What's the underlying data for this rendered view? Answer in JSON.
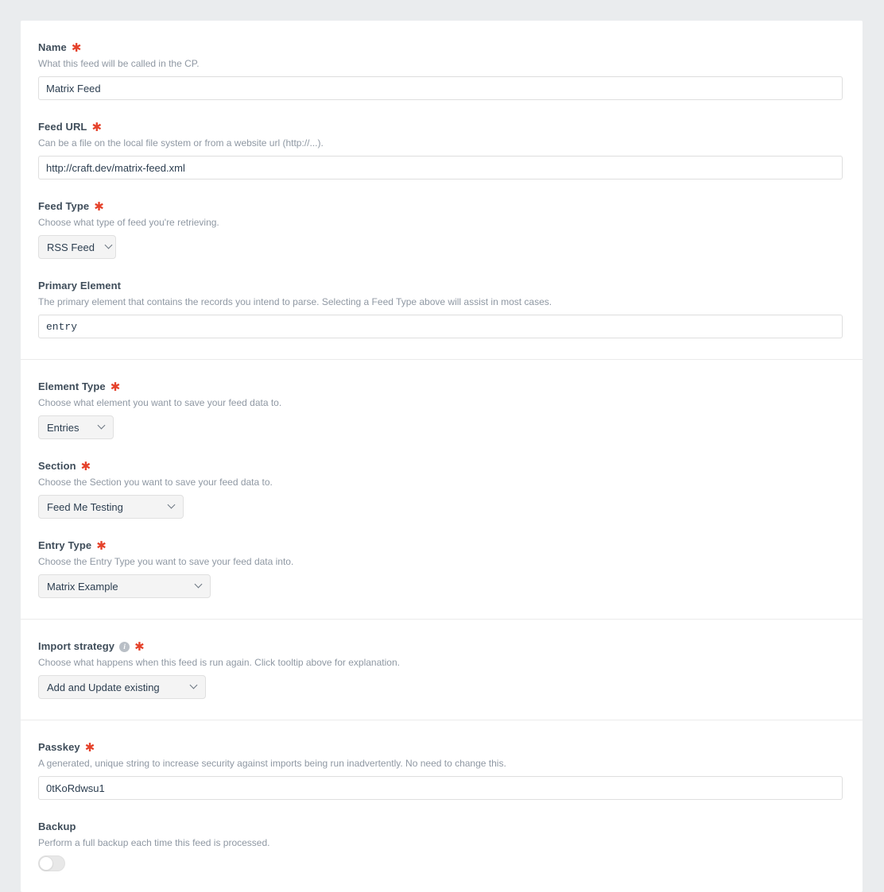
{
  "form": {
    "sections": [
      {
        "name": "feed-source",
        "fields": [
          {
            "key": "name",
            "label": "Name",
            "required": true,
            "help": "What this feed will be called in the CP.",
            "control": "text",
            "value": "Matrix Feed"
          },
          {
            "key": "feed-url",
            "label": "Feed URL",
            "required": true,
            "help": "Can be a file on the local file system or from a website url (http://...).",
            "control": "text",
            "value": "http://craft.dev/matrix-feed.xml"
          },
          {
            "key": "feed-type",
            "label": "Feed Type",
            "required": true,
            "help": "Choose what type of feed you're retrieving.",
            "control": "select",
            "value": "RSS Feed"
          },
          {
            "key": "primary-element",
            "label": "Primary Element",
            "required": false,
            "help": "The primary element that contains the records you intend to parse. Selecting a Feed Type above will assist in most cases.",
            "control": "text-mono",
            "value": "entry"
          }
        ]
      },
      {
        "name": "target-element",
        "fields": [
          {
            "key": "element-type",
            "label": "Element Type",
            "required": true,
            "help": "Choose what element you want to save your feed data to.",
            "control": "select",
            "value": "Entries"
          },
          {
            "key": "section",
            "label": "Section",
            "required": true,
            "help": "Choose the Section you want to save your feed data to.",
            "control": "select",
            "value": "Feed Me Testing"
          },
          {
            "key": "entry-type",
            "label": "Entry Type",
            "required": true,
            "help": "Choose the Entry Type you want to save your feed data into.",
            "control": "select",
            "value": "Matrix Example"
          }
        ]
      },
      {
        "name": "import-strategy",
        "fields": [
          {
            "key": "import-strategy",
            "label": "Import strategy",
            "required": true,
            "info": true,
            "help": "Choose what happens when this feed is run again. Click tooltip above for explanation.",
            "control": "select",
            "value": "Add and Update existing"
          }
        ]
      },
      {
        "name": "security-backup",
        "fields": [
          {
            "key": "passkey",
            "label": "Passkey",
            "required": true,
            "help": "A generated, unique string to increase security against imports being run inadvertently. No need to change this.",
            "control": "text",
            "value": "0tKoRdwsu1"
          },
          {
            "key": "backup",
            "label": "Backup",
            "required": false,
            "help": "Perform a full backup each time this feed is processed.",
            "control": "toggle",
            "value": "off"
          }
        ]
      }
    ]
  },
  "icons": {
    "info": "i"
  },
  "colors": {
    "page_background": "#eaecee",
    "card_background": "#ffffff",
    "label": "#3f4d5a",
    "help_text": "#8f98a3",
    "required_asterisk": "#e5422b",
    "input_border": "#dfdfdf",
    "select_background": "#f4f4f4",
    "divider": "#ebebeb"
  }
}
